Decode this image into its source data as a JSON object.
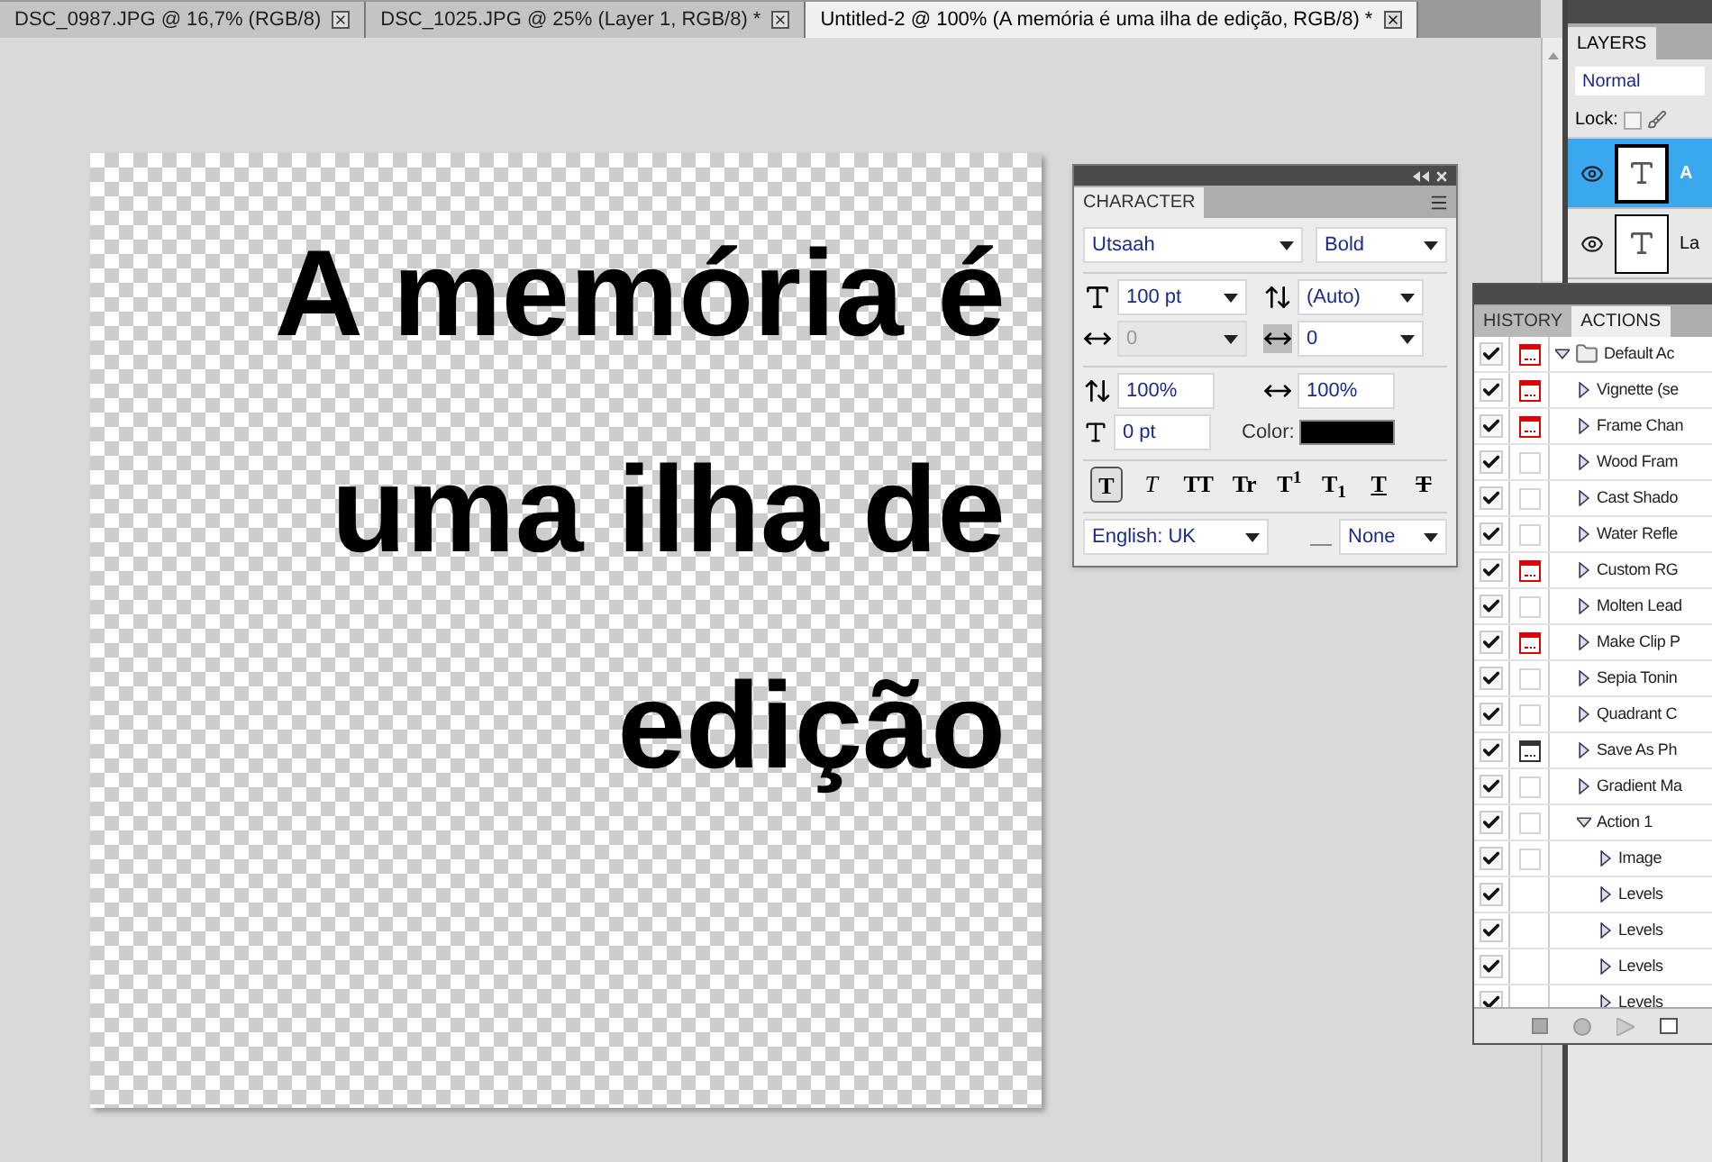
{
  "tabs": [
    {
      "label": "DSC_0987.JPG @ 16,7% (RGB/8)",
      "selected": false
    },
    {
      "label": "DSC_1025.JPG @ 25% (Layer 1, RGB/8) *",
      "selected": false
    },
    {
      "label": "Untitled-2 @ 100% (A memória é uma ilha de edição, RGB/8) *",
      "selected": true
    }
  ],
  "canvas": {
    "lines": [
      "A memória é",
      "uma ilha de",
      "edição"
    ]
  },
  "character": {
    "title": "CHARACTER",
    "font": "Utsaah",
    "style": "Bold",
    "size": "100 pt",
    "leading": "(Auto)",
    "kerning": "0",
    "kerning_disabled": true,
    "tracking": "0",
    "vscale": "100%",
    "hscale": "100%",
    "baseline": "0 pt",
    "color_label": "Color:",
    "color": "#000000",
    "style_buttons": [
      {
        "kind": "bold",
        "label": "T",
        "selected": true
      },
      {
        "kind": "italic",
        "label": "T",
        "selected": false
      },
      {
        "kind": "caps",
        "label": "TT",
        "selected": false
      },
      {
        "kind": "smallcaps",
        "label": "Tr",
        "selected": false
      },
      {
        "kind": "super",
        "label": "T$^{1}$",
        "selected": false
      },
      {
        "kind": "sub",
        "label": "T$_{1}$",
        "selected": false
      },
      {
        "kind": "underline",
        "label": "T",
        "selected": false
      },
      {
        "kind": "strike",
        "label": "T",
        "selected": false
      }
    ],
    "language": "English: UK",
    "antialias": "None"
  },
  "actions_panel": {
    "tabs": [
      {
        "label": "HISTORY",
        "selected": false
      },
      {
        "label": "ACTIONS",
        "selected": true
      }
    ],
    "items": [
      {
        "label": "Default Ac",
        "checked": true,
        "dialog": true,
        "dialog_partial": false,
        "expanded": true,
        "children": [
          {
            "label": "Vignette (se",
            "checked": true,
            "dialog": true,
            "dialog_partial": false,
            "expanded": false
          },
          {
            "label": "Frame Chan",
            "checked": true,
            "dialog": true,
            "dialog_partial": false,
            "expanded": false
          },
          {
            "label": "Wood Fram",
            "checked": true,
            "dialog": false,
            "dialog_partial": false,
            "expanded": false
          },
          {
            "label": "Cast Shado",
            "checked": true,
            "dialog": false,
            "dialog_partial": false,
            "expanded": false
          },
          {
            "label": "Water Refle",
            "checked": true,
            "dialog": false,
            "dialog_partial": false,
            "expanded": false
          },
          {
            "label": "Custom RG",
            "checked": true,
            "dialog": true,
            "dialog_partial": false,
            "expanded": false
          },
          {
            "label": "Molten Lead",
            "checked": true,
            "dialog": false,
            "dialog_partial": false,
            "expanded": false
          },
          {
            "label": "Make Clip P",
            "checked": true,
            "dialog": true,
            "dialog_partial": false,
            "expanded": false
          },
          {
            "label": "Sepia Tonin",
            "checked": true,
            "dialog": false,
            "dialog_partial": false,
            "expanded": false
          },
          {
            "label": "Quadrant C",
            "checked": true,
            "dialog": false,
            "dialog_partial": false,
            "expanded": false
          },
          {
            "label": "Save As Ph",
            "checked": true,
            "dialog": false,
            "dialog_partial": true,
            "expanded": false
          },
          {
            "label": "Gradient Ma",
            "checked": true,
            "dialog": false,
            "dialog_partial": false,
            "expanded": false
          },
          {
            "label": "Action 1",
            "checked": true,
            "dialog": false,
            "dialog_partial": false,
            "expanded": true,
            "children": [
              {
                "label": "Image",
                "checked": true,
                "dialog": false,
                "dialog_partial": false,
                "expanded": false
              },
              {
                "label": "Levels",
                "checked": true,
                "expanded": false
              },
              {
                "label": "Levels",
                "checked": true,
                "expanded": false
              },
              {
                "label": "Levels",
                "checked": true,
                "expanded": false
              },
              {
                "label": "Levels",
                "checked": true,
                "expanded": false
              }
            ]
          }
        ]
      }
    ]
  },
  "layers": {
    "title": "LAYERS",
    "blend_mode": "Normal",
    "lock_label": "Lock:",
    "rows": [
      {
        "name": "A",
        "selected": true,
        "visible": true
      },
      {
        "name": "La",
        "selected": false,
        "visible": true
      }
    ]
  }
}
